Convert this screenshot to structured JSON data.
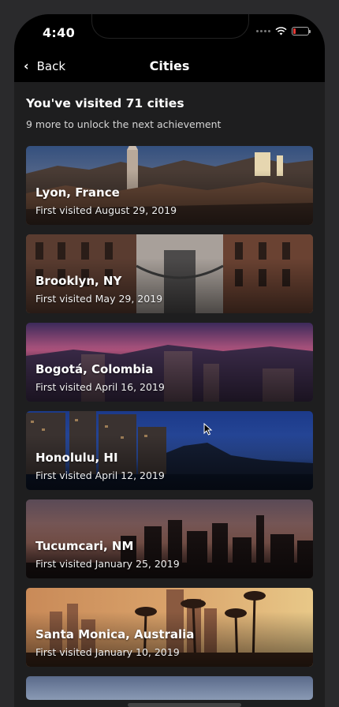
{
  "status": {
    "time": "4:40",
    "battery_color": "#e53935"
  },
  "nav": {
    "back_label": "Back",
    "title": "Cities"
  },
  "summary": {
    "headline": "You've visited 71 cities",
    "subline": "9 more to unlock the next achievement"
  },
  "cities": [
    {
      "name": "Lyon, France",
      "date": "First visited August 29, 2019"
    },
    {
      "name": "Brooklyn, NY",
      "date": "First visited May 29, 2019"
    },
    {
      "name": "Bogotá, Colombia",
      "date": "First visited April 16, 2019"
    },
    {
      "name": "Honolulu, HI",
      "date": "First visited April 12, 2019"
    },
    {
      "name": "Tucumcari, NM",
      "date": "First visited January 25, 2019"
    },
    {
      "name": "Santa Monica, Australia",
      "date": "First visited January 10, 2019"
    }
  ]
}
